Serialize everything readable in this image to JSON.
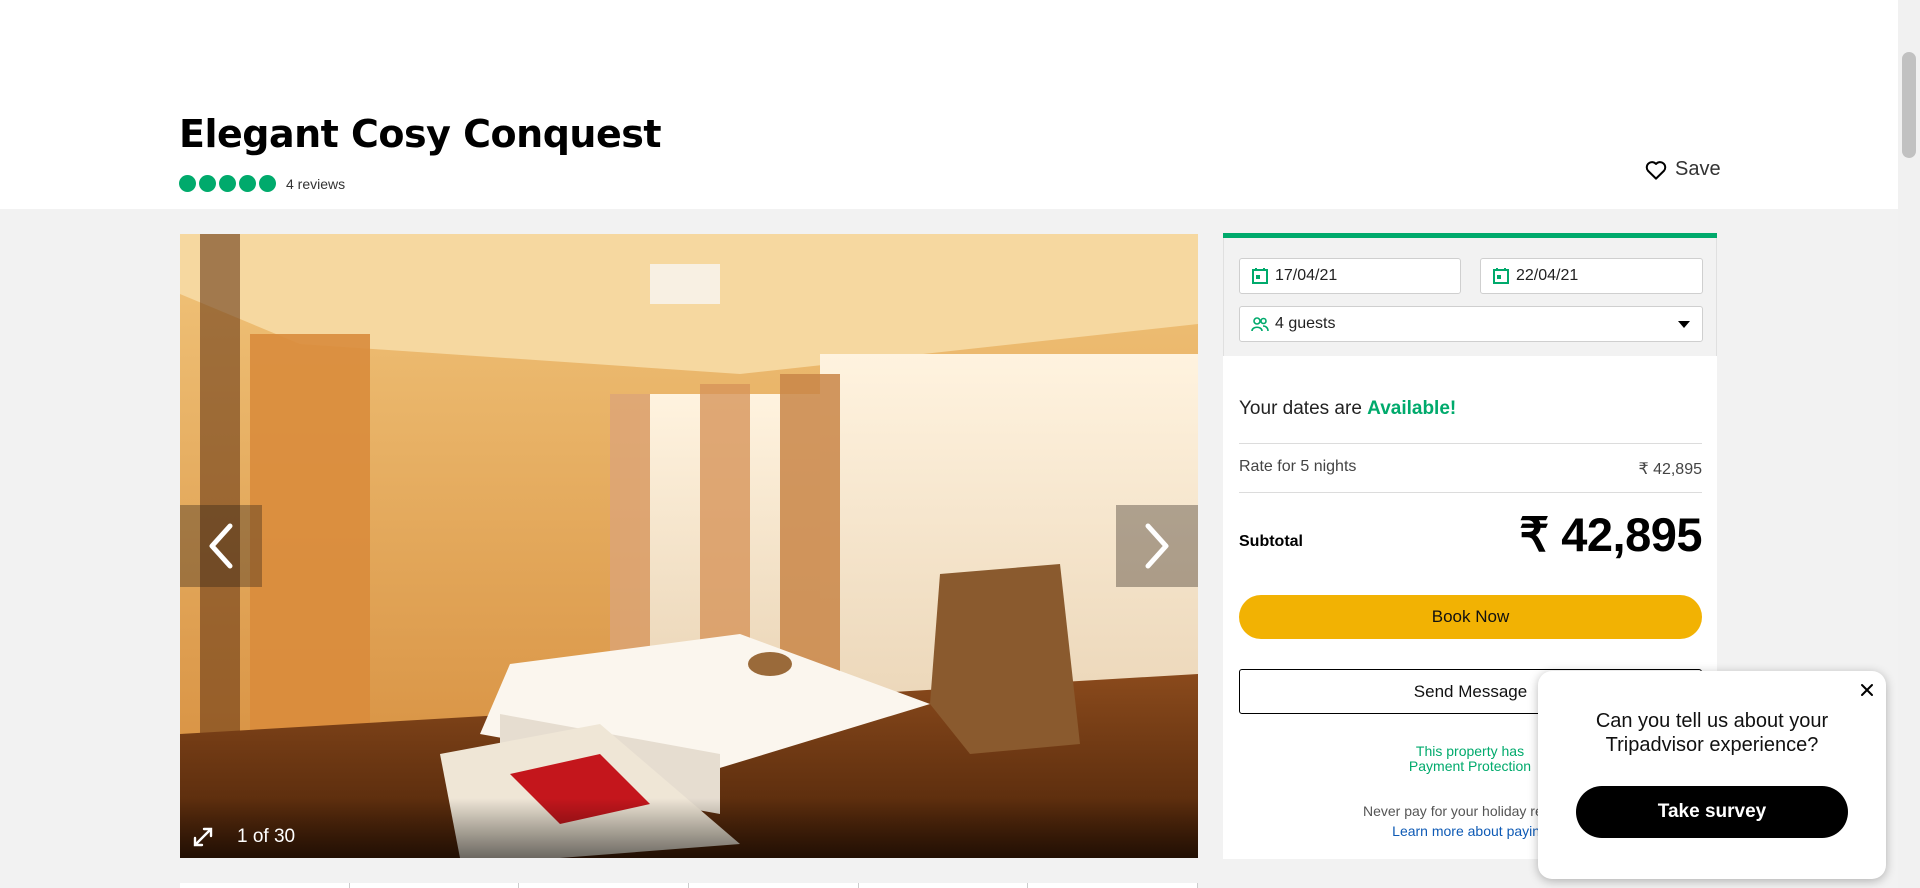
{
  "listing": {
    "title": "Elegant Cosy Conquest",
    "rating_bubbles": 5,
    "reviews": "4 reviews",
    "save_label": "Save"
  },
  "gallery": {
    "counter": "1 of 30"
  },
  "booking": {
    "checkin": "17/04/21",
    "checkout": "22/04/21",
    "guests": "4 guests",
    "availability_prefix": "Your dates are ",
    "availability_status": "Available!",
    "rate_label": "Rate for 5 nights",
    "rate_value": "₹ 42,895",
    "subtotal_label": "Subtotal",
    "subtotal_value": "₹ 42,895",
    "book_now": "Book Now",
    "send_message": "Send Message",
    "protection_line1": "This property has",
    "protection_line2": "Payment Protection",
    "never_pay": "Never pay for your holiday rental b",
    "learn_more": "Learn more about paying"
  },
  "survey": {
    "question": "Can you tell us about your Tripadvisor experience?",
    "button": "Take survey"
  },
  "colors": {
    "accent_green": "#00aa6c",
    "book_yellow": "#f2b203"
  },
  "icons": [
    "heart-icon",
    "calendar-icon",
    "guests-icon",
    "chevron-left-icon",
    "chevron-right-icon",
    "expand-icon",
    "close-icon"
  ]
}
